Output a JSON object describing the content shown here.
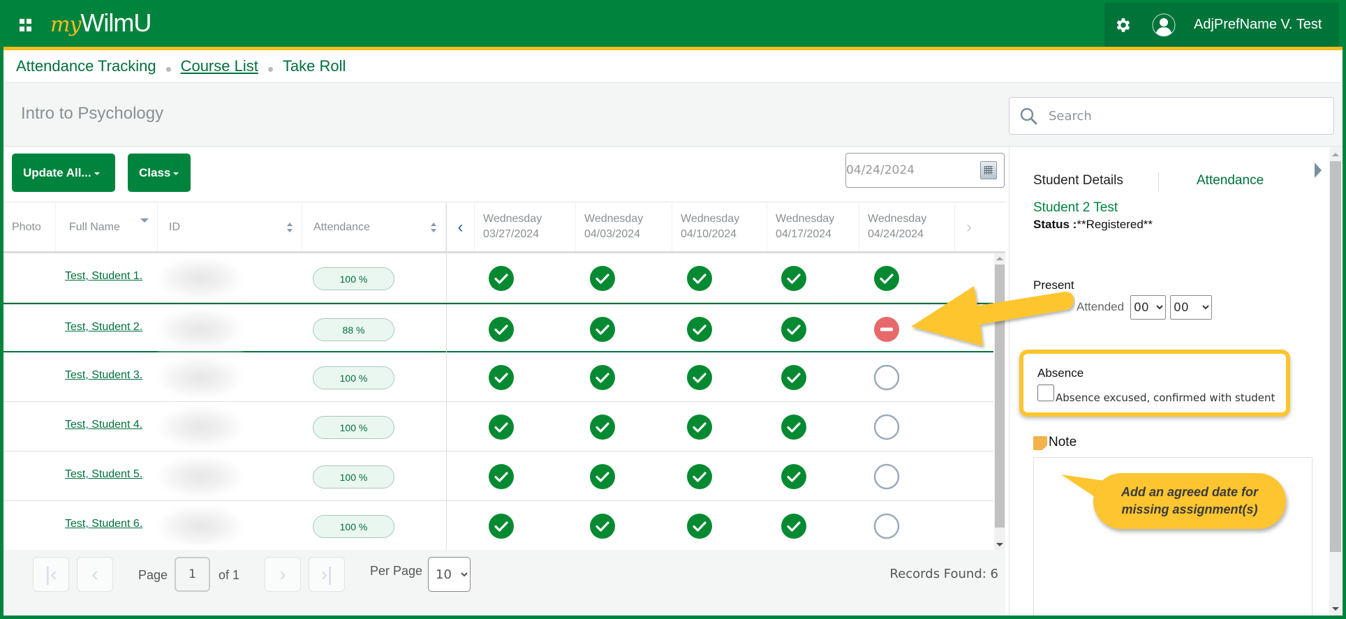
{
  "app": {
    "logo_prefix": "my",
    "logo_text": "WilmU",
    "user_name": "AdjPrefName V. Test",
    "colors": {
      "brand_green": "#00843d",
      "brand_gold": "#f6bd1e",
      "absent_red": "#e8696b",
      "annotation_yellow": "#fdc52f"
    }
  },
  "breadcrumb": [
    {
      "label": "Attendance Tracking",
      "link": false
    },
    {
      "label": "Course List",
      "link": true
    },
    {
      "label": "Take Roll",
      "link": false
    }
  ],
  "course_title": "Intro to Psychology",
  "search": {
    "placeholder": "Search",
    "value": ""
  },
  "toolbar": {
    "update_all_label": "Update All...",
    "class_label": "Class",
    "date_value": "04/24/2024"
  },
  "table": {
    "columns": {
      "photo": "Photo",
      "full_name": "Full Name",
      "id": "ID",
      "attendance": "Attendance"
    },
    "dates": [
      {
        "day": "Wednesday",
        "date": "03/27/2024"
      },
      {
        "day": "Wednesday",
        "date": "04/03/2024"
      },
      {
        "day": "Wednesday",
        "date": "04/10/2024"
      },
      {
        "day": "Wednesday",
        "date": "04/17/2024"
      },
      {
        "day": "Wednesday",
        "date": "04/24/2024"
      }
    ],
    "rows": [
      {
        "name": "Test, Student 1.",
        "attendance": "100 %",
        "marks": [
          "present",
          "present",
          "present",
          "present",
          "present"
        ],
        "selected": false
      },
      {
        "name": "Test, Student 2.",
        "attendance": "88 %",
        "marks": [
          "present",
          "present",
          "present",
          "present",
          "absent"
        ],
        "selected": true
      },
      {
        "name": "Test, Student 3.",
        "attendance": "100 %",
        "marks": [
          "present",
          "present",
          "present",
          "present",
          "unmarked"
        ],
        "selected": false
      },
      {
        "name": "Test, Student 4.",
        "attendance": "100 %",
        "marks": [
          "present",
          "present",
          "present",
          "present",
          "unmarked"
        ],
        "selected": false
      },
      {
        "name": "Test, Student 5.",
        "attendance": "100 %",
        "marks": [
          "present",
          "present",
          "present",
          "present",
          "unmarked"
        ],
        "selected": false
      },
      {
        "name": "Test, Student 6.",
        "attendance": "100 %",
        "marks": [
          "present",
          "present",
          "present",
          "present",
          "unmarked"
        ],
        "selected": false
      }
    ]
  },
  "pagination": {
    "page_label": "Page",
    "page_value": "1",
    "of_label": "of 1",
    "per_page_label": "Per Page",
    "per_page_value": "10",
    "records_found": "Records Found: 6"
  },
  "details_panel": {
    "tab_details": "Student Details",
    "tab_attendance": "Attendance",
    "student_name": "Student 2 Test",
    "status_label": "Status :",
    "status_value": "**Registered**",
    "present_label": "Present",
    "attended_label": "Attended",
    "hours_value": "00",
    "minutes_value": "00",
    "absence_label": "Absence",
    "absence_excused_label": "Absence excused, confirmed with student",
    "absence_excused_checked": false,
    "note_label": "Note",
    "note_value": ""
  },
  "annotations": {
    "callout_text_line1": "Add an agreed date for",
    "callout_text_line2": "missing assignment(s)"
  }
}
